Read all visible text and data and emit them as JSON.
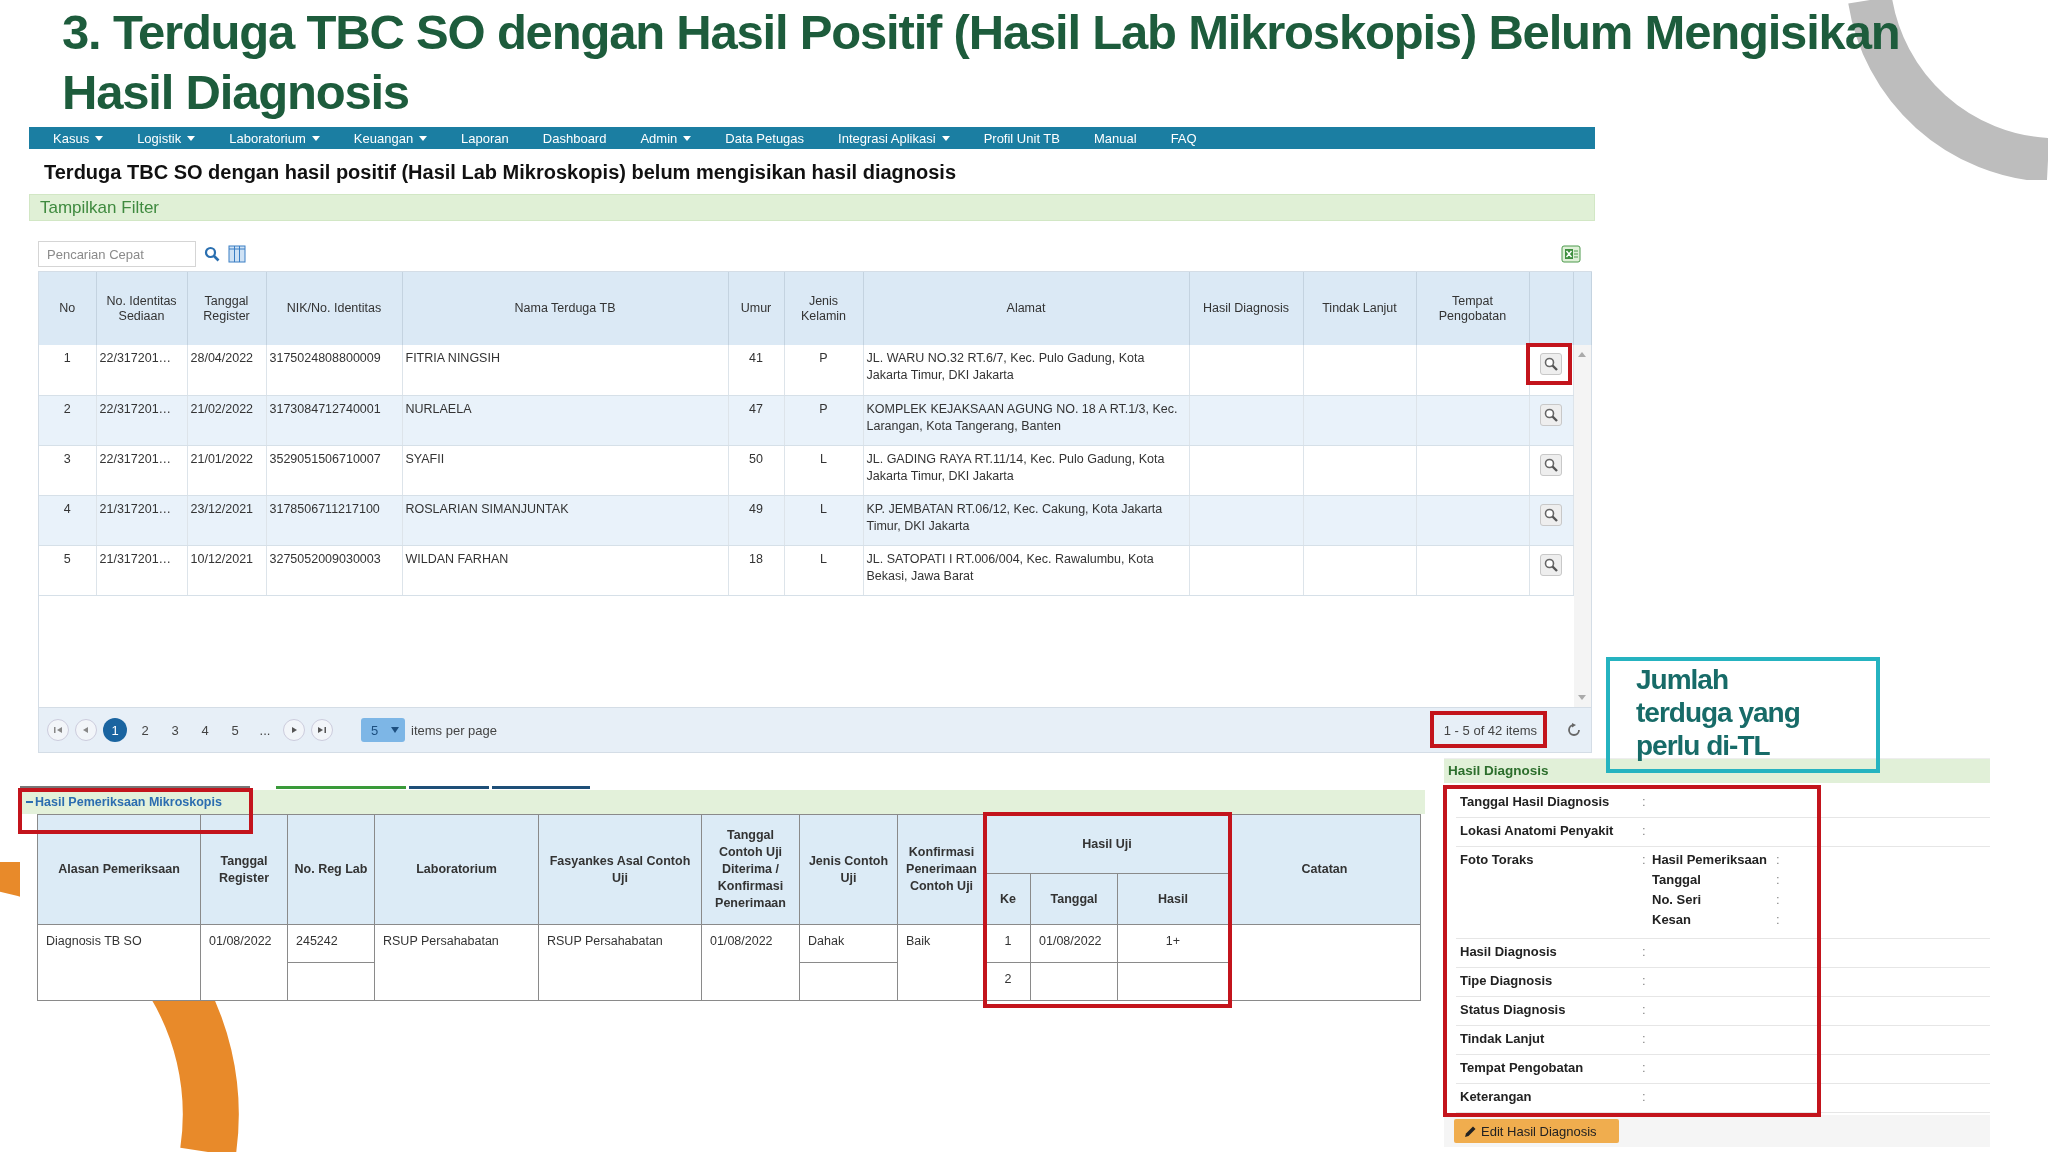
{
  "title_lines": [
    "3. Terduga TBC SO dengan Hasil Positif (Hasil Lab Mikroskopis) Belum Mengisikan",
    "Hasil Diagnosis"
  ],
  "main_panel": {
    "nav": [
      {
        "label": "Kasus",
        "dropdown": true
      },
      {
        "label": "Logistik",
        "dropdown": true
      },
      {
        "label": "Laboratorium",
        "dropdown": true
      },
      {
        "label": "Keuangan",
        "dropdown": true
      },
      {
        "label": "Laporan",
        "dropdown": false
      },
      {
        "label": "Dashboard",
        "dropdown": false
      },
      {
        "label": "Admin",
        "dropdown": true
      },
      {
        "label": "Data Petugas",
        "dropdown": false
      },
      {
        "label": "Integrasi Aplikasi",
        "dropdown": true
      },
      {
        "label": "Profil Unit TB",
        "dropdown": false
      },
      {
        "label": "Manual",
        "dropdown": false
      },
      {
        "label": "FAQ",
        "dropdown": false
      }
    ],
    "heading": "Terduga TBC SO dengan hasil positif (Hasil Lab Mikroskopis) belum mengisikan hasil diagnosis",
    "filter_label": "Tampilkan Filter",
    "search": {
      "placeholder": "Pencarian Cepat"
    },
    "columns": [
      "No",
      "No. Identitas Sediaan",
      "Tanggal Register",
      "NIK/No. Identitas",
      "Nama Terduga TB",
      "Umur",
      "Jenis Kelamin",
      "Alamat",
      "Hasil Diagnosis",
      "Tindak Lanjut",
      "Tempat Pengobatan"
    ],
    "rows": [
      {
        "no": "1",
        "id": "22/317201…",
        "date": "28/04/2022",
        "nik": "3175024808800009",
        "name": "FITRIA NINGSIH",
        "age": "41",
        "sex": "P",
        "address": "JL. WARU NO.32 RT.6/7, Kec. Pulo Gadung, Kota Jakarta Timur, DKI Jakarta",
        "action_highlighted": true
      },
      {
        "no": "2",
        "id": "22/317201…",
        "date": "21/02/2022",
        "nik": "3173084712740001",
        "name": "NURLAELA",
        "age": "47",
        "sex": "P",
        "address": "KOMPLEK KEJAKSAAN AGUNG NO. 18 A RT.1/3, Kec. Larangan, Kota Tangerang, Banten",
        "action_highlighted": false
      },
      {
        "no": "3",
        "id": "22/317201…",
        "date": "21/01/2022",
        "nik": "3529051506710007",
        "name": "SYAFII",
        "age": "50",
        "sex": "L",
        "address": "JL. GADING RAYA RT.11/14, Kec. Pulo Gadung, Kota Jakarta Timur, DKI Jakarta",
        "action_highlighted": false
      },
      {
        "no": "4",
        "id": "21/317201…",
        "date": "23/12/2021",
        "nik": "3178506711217100",
        "name": "ROSLARIAN SIMANJUNTAK",
        "age": "49",
        "sex": "L",
        "address": "KP. JEMBATAN RT.06/12, Kec. Cakung, Kota Jakarta Timur, DKI Jakarta",
        "action_highlighted": false
      },
      {
        "no": "5",
        "id": "21/317201…",
        "date": "10/12/2021",
        "nik": "3275052009030003",
        "name": "WILDAN FARHAN",
        "age": "18",
        "sex": "L",
        "address": "JL. SATOPATI I RT.006/004, Kec. Rawalumbu, Kota Bekasi, Jawa Barat",
        "action_highlighted": false
      }
    ],
    "pager": {
      "pages": [
        {
          "label": "1",
          "selected": true
        },
        {
          "label": "2",
          "selected": false
        },
        {
          "label": "3",
          "selected": false
        },
        {
          "label": "4",
          "selected": false
        },
        {
          "label": "5",
          "selected": false
        },
        {
          "label": "...",
          "selected": false
        }
      ],
      "page_size": "5",
      "per_page_label": "items per page",
      "summary": "1 - 5 of 42 items",
      "summary_highlighted": true
    }
  },
  "callout": {
    "text": "Jumlah terduga yang perlu di-TL"
  },
  "microscopy": {
    "title": "Hasil Pemeriksaan Mikroskopis",
    "highlighted": true,
    "columns": [
      {
        "kind": "single",
        "label": "Alasan Pemeriksaan",
        "merged": true
      },
      {
        "kind": "single",
        "label": "Tanggal Register",
        "merged": true
      },
      {
        "kind": "single",
        "label": "No. Reg Lab",
        "merged": false
      },
      {
        "kind": "single",
        "label": "Laboratorium",
        "merged": true
      },
      {
        "kind": "single",
        "label": "Fasyankes Asal Contoh Uji",
        "merged": true
      },
      {
        "kind": "single",
        "label": "Tanggal Contoh Uji Diterima / Konfirmasi Penerimaan",
        "merged": true
      },
      {
        "kind": "single",
        "label": "Jenis Contoh Uji",
        "merged": false
      },
      {
        "kind": "single",
        "label": "Konfirmasi Penerimaan Contoh Uji",
        "merged": true
      },
      {
        "kind": "group",
        "label": "Hasil Uji",
        "highlighted": true,
        "subcolumns": [
          "Ke",
          "Tanggal",
          "Hasil"
        ]
      },
      {
        "kind": "single",
        "label": "Catatan",
        "merged": true
      }
    ],
    "records": [
      {
        "cells": [
          "Diagnosis TB SO",
          "01/08/2022",
          "245242",
          "RSUP Persahabatan",
          "RSUP Persahabatan",
          "01/08/2022",
          "Dahak",
          "Baik"
        ],
        "tests": [
          {
            "ke": "1",
            "tanggal": "01/08/2022",
            "hasil": "1+"
          },
          {
            "ke": "2"
          }
        ]
      }
    ]
  },
  "diagnosis": {
    "title": "Hasil Diagnosis",
    "highlighted": true,
    "fields": [
      {
        "kind": "field",
        "label": "Tanggal Hasil Diagnosis",
        "colon": ":"
      },
      {
        "kind": "field",
        "label": "Lokasi Anatomi Penyakit",
        "colon": ":"
      },
      {
        "kind": "group",
        "label": "Foto Toraks",
        "colon": ":",
        "items": [
          {
            "label": "Hasil Pemeriksaan",
            "colon": ":"
          },
          {
            "label": "Tanggal",
            "colon": ":"
          },
          {
            "label": "No. Seri",
            "colon": ":"
          },
          {
            "label": "Kesan",
            "colon": ":"
          }
        ]
      },
      {
        "kind": "field",
        "label": "Hasil Diagnosis",
        "colon": ":"
      },
      {
        "kind": "field",
        "label": "Tipe Diagnosis",
        "colon": ":"
      },
      {
        "kind": "field",
        "label": "Status Diagnosis",
        "colon": ":"
      },
      {
        "kind": "field",
        "label": "Tindak Lanjut",
        "colon": ":"
      },
      {
        "kind": "field",
        "label": "Tempat Pengobatan",
        "colon": ":"
      },
      {
        "kind": "field",
        "label": "Keterangan",
        "colon": ":"
      }
    ],
    "edit_button": "Edit Hasil Diagnosis"
  }
}
